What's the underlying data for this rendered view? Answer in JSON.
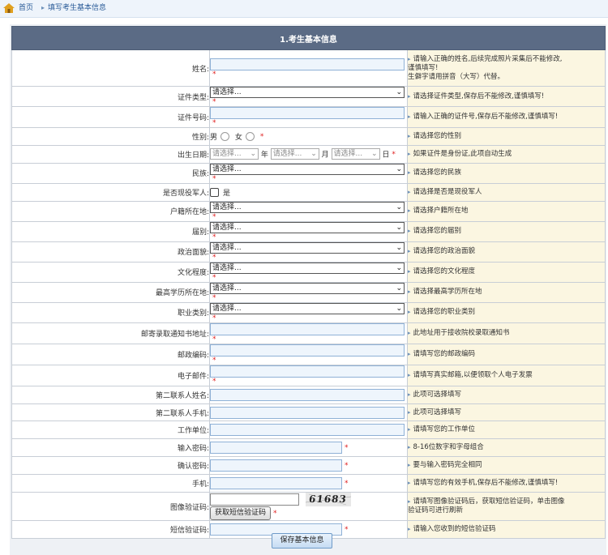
{
  "breadcrumb": {
    "home": "首页",
    "current": "填写考生基本信息"
  },
  "section_title": "1.考生基本信息",
  "fields": {
    "name": {
      "label": "姓名:",
      "tip_lines": [
        "请输入正确的姓名,后续完成照片采集后不能修改,",
        "谨慎填写!",
        "生僻字请用拼音（大写）代替。"
      ]
    },
    "id_type": {
      "label": "证件类型:",
      "value": "请选择...",
      "tip": "请选择证件类型,保存后不能修改,谨慎填写!"
    },
    "id_number": {
      "label": "证件号码:",
      "tip": "请输入正确的证件号,保存后不能修改,谨慎填写!"
    },
    "gender": {
      "label": "性别:",
      "male": "男",
      "female": "女",
      "tip": "请选择您的性别"
    },
    "birth_date": {
      "label": "出生日期:",
      "year_value": "请选择...",
      "year_unit": "年",
      "month_value": "请选择...",
      "month_unit": "月",
      "day_value": "请选择...",
      "day_unit": "日",
      "tip": "如果证件是身份证,此项自动生成"
    },
    "ethnicity": {
      "label": "民族:",
      "value": "请选择...",
      "tip": "请选择您的民族"
    },
    "veteran": {
      "label": "是否现役军人:",
      "option": "是",
      "tip": "请选择是否是现役军人"
    },
    "household": {
      "label": "户籍所在地:",
      "value": "请选择...",
      "tip": "请选择户籍所在地"
    },
    "cohort": {
      "label": "届别:",
      "value": "请选择...",
      "tip": "请选择您的届别"
    },
    "political": {
      "label": "政治面貌:",
      "value": "请选择...",
      "tip": "请选择您的政治面貌"
    },
    "education": {
      "label": "文化程度:",
      "value": "请选择...",
      "tip": "请选择您的文化程度"
    },
    "edu_location": {
      "label": "最高学历所在地:",
      "value": "请选择...",
      "tip": "请选择最高学历所在地"
    },
    "occupation": {
      "label": "职业类别:",
      "value": "请选择...",
      "tip": "请选择您的职业类别"
    },
    "mail_address": {
      "label": "邮寄录取通知书地址:",
      "tip": "此地址用于接收院校录取通知书"
    },
    "postcode": {
      "label": "邮政编码:",
      "tip": "请填写您的邮政编码"
    },
    "email": {
      "label": "电子邮件:",
      "tip": "请填写真实邮箱,以便领取个人电子发票"
    },
    "contact2_name": {
      "label": "第二联系人姓名:",
      "tip": "此项可选择填写"
    },
    "contact2_phone": {
      "label": "第二联系人手机:",
      "tip": "此项可选择填写"
    },
    "workplace": {
      "label": "工作单位:",
      "tip": "请填写您的工作单位"
    },
    "password": {
      "label": "输入密码:",
      "tip": "8-16位数字和字母组合"
    },
    "password_confirm": {
      "label": "确认密码:",
      "tip": "要与输入密码完全相同"
    },
    "mobile": {
      "label": "手机:",
      "tip": "请填写您的有效手机,保存后不能修改,谨慎填写!"
    },
    "captcha": {
      "label": "图像验证码:",
      "image_text": "61683",
      "sms_button": "获取短信验证码",
      "tip_lines": [
        "请填写图像验证码后，获取短信验证码，单击图像",
        "验证码可进行刷新"
      ]
    },
    "sms_code": {
      "label": "短信验证码:",
      "tip": "请输入您收到的短信验证码"
    }
  },
  "required_mark": "*",
  "save_button": "保存基本信息",
  "colors": {
    "header_bg": "#5b6b85",
    "tip_bg": "#fbf6e1",
    "input_bg": "#eef5fc",
    "required": "#e02020"
  }
}
